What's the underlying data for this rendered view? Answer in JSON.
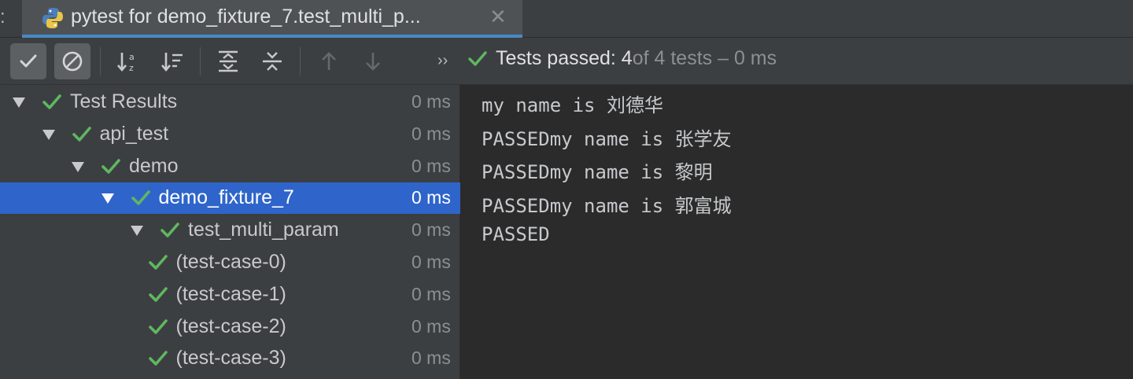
{
  "tab": {
    "prefix": ":",
    "title": "pytest for demo_fixture_7.test_multi_p...",
    "close": "✕"
  },
  "toolbar": {
    "buttons": [
      {
        "name": "show-passed-button",
        "icon": "check-icon",
        "pressed": true
      },
      {
        "name": "show-ignored-button",
        "icon": "cancel-icon",
        "pressed": true
      },
      {
        "name": "sort-alphabetically-button",
        "icon": "sort-az-icon",
        "pressed": false
      },
      {
        "name": "sort-by-duration-button",
        "icon": "sort-duration-icon",
        "pressed": false
      },
      {
        "name": "expand-all-button",
        "icon": "expand-all-icon",
        "pressed": false
      },
      {
        "name": "collapse-all-button",
        "icon": "collapse-all-icon",
        "pressed": false
      },
      {
        "name": "previous-failed-button",
        "icon": "arrow-up-icon",
        "pressed": false
      },
      {
        "name": "next-failed-button",
        "icon": "arrow-down-icon",
        "pressed": false
      }
    ],
    "more": "››",
    "status_passed": "Tests passed: 4",
    "status_rest": " of 4 tests – 0 ms"
  },
  "tree": {
    "rows": [
      {
        "label": "Test Results",
        "time": "0 ms",
        "level": 0,
        "expanded": true,
        "selected": false
      },
      {
        "label": "api_test",
        "time": "0 ms",
        "level": 1,
        "expanded": true,
        "selected": false
      },
      {
        "label": "demo",
        "time": "0 ms",
        "level": 2,
        "expanded": true,
        "selected": false
      },
      {
        "label": "demo_fixture_7",
        "time": "0 ms",
        "level": 3,
        "expanded": true,
        "selected": true
      },
      {
        "label": "test_multi_param",
        "time": "0 ms",
        "level": 4,
        "expanded": true,
        "selected": false
      },
      {
        "label": "(test-case-0)",
        "time": "0 ms",
        "level": 5,
        "expanded": null,
        "selected": false
      },
      {
        "label": "(test-case-1)",
        "time": "0 ms",
        "level": 5,
        "expanded": null,
        "selected": false
      },
      {
        "label": "(test-case-2)",
        "time": "0 ms",
        "level": 5,
        "expanded": null,
        "selected": false
      },
      {
        "label": "(test-case-3)",
        "time": "0 ms",
        "level": 5,
        "expanded": null,
        "selected": false
      }
    ]
  },
  "console": {
    "lines": [
      "my name is 刘德华",
      "PASSEDmy name is 张学友",
      "PASSEDmy name is 黎明",
      "PASSEDmy name is 郭富城",
      "PASSED"
    ]
  },
  "colors": {
    "accent": "#2f65ca",
    "pass_green": "#5fb760",
    "tab_underline": "#4a88c7"
  }
}
